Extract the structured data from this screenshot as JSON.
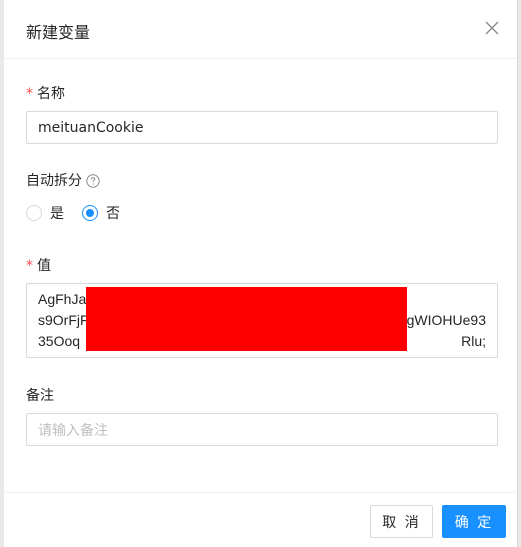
{
  "modal": {
    "title": "新建变量"
  },
  "form": {
    "name": {
      "required_mark": "*",
      "label": "名称",
      "value": "meituanCookie"
    },
    "auto_split": {
      "label": "自动拆分",
      "options": [
        {
          "label": "是",
          "checked": false
        },
        {
          "label": "否",
          "checked": true
        }
      ]
    },
    "value": {
      "required_mark": "*",
      "label": "值",
      "lines": [
        {
          "left": "AgFhJa",
          "right": ""
        },
        {
          "left": "s9OrFjF",
          "right": "gWIOHUe93"
        },
        {
          "left": "35Ooq",
          "right": "Rlu;"
        }
      ]
    },
    "remark": {
      "label": "备注",
      "placeholder": "请输入备注"
    }
  },
  "footer": {
    "cancel_label": "取 消",
    "ok_label": "确 定"
  },
  "colors": {
    "primary": "#1890ff",
    "required": "#ff4d4f",
    "redaction": "#ff0000"
  }
}
